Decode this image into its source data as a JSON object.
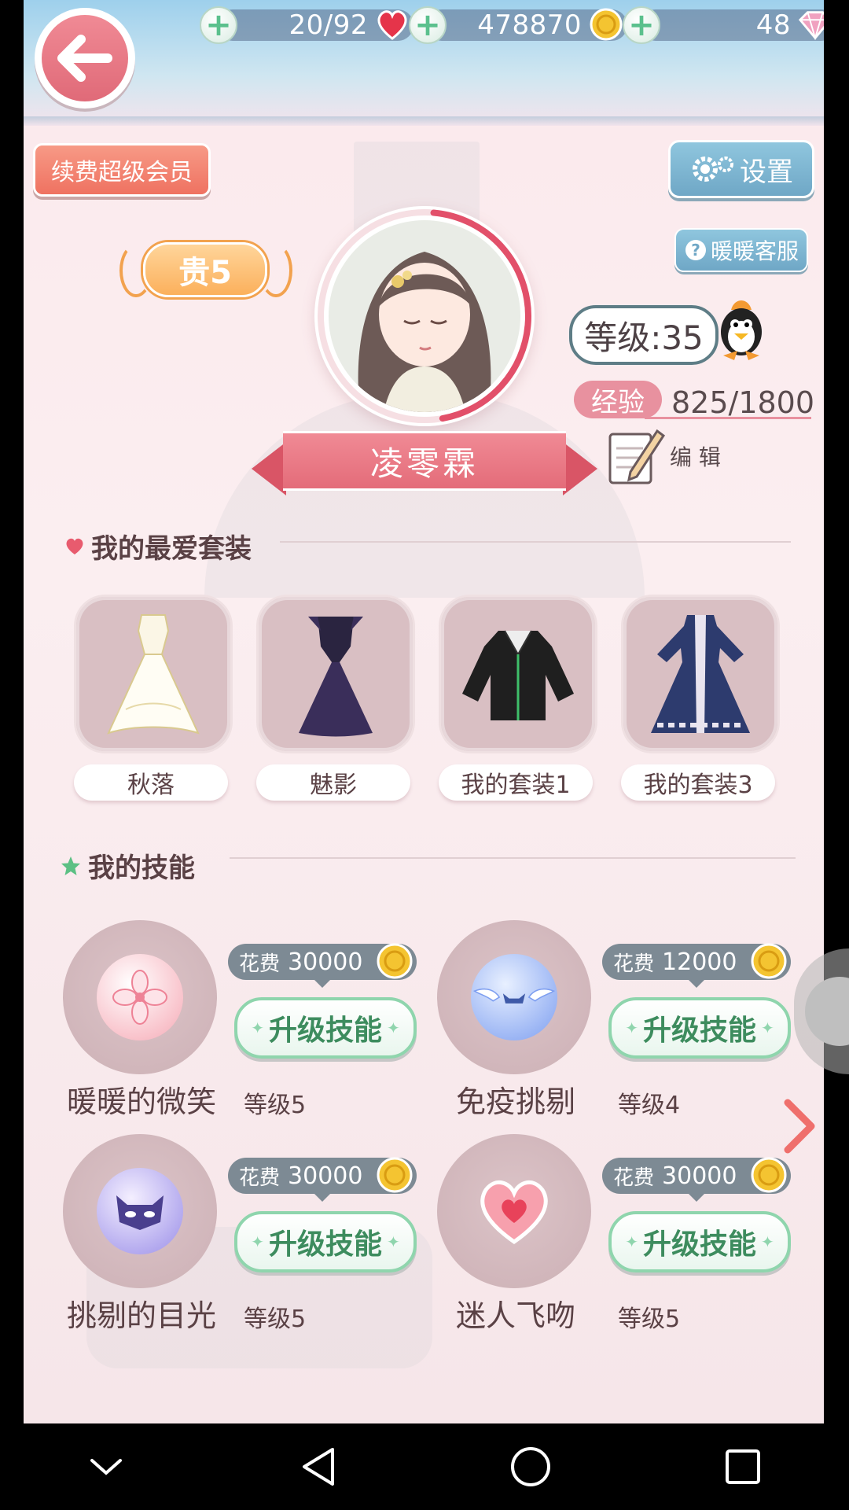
{
  "resources": {
    "stamina": "20/92",
    "gold": "478870",
    "diamonds": "48"
  },
  "buttons": {
    "vip": "续费超级会员",
    "settings": "设置",
    "service": "暖暖客服",
    "edit": "编 辑"
  },
  "profile": {
    "noble_rank": "贵5",
    "level": "等级:35",
    "exp_label": "经验",
    "exp_value": "825/1800",
    "name": "凌零霖"
  },
  "favorites": {
    "title": "我的最爱套装",
    "items": [
      {
        "label": "秋落"
      },
      {
        "label": "魅影"
      },
      {
        "label": "我的套装1"
      },
      {
        "label": "我的套装3"
      }
    ]
  },
  "skills": {
    "title": "我的技能",
    "cost_label": "花费",
    "upgrade_label": "升级技能",
    "items": [
      {
        "name": "暖暖的微笑",
        "cost": "30000",
        "level": "等级5"
      },
      {
        "name": "免疫挑剔",
        "cost": "12000",
        "level": "等级4"
      },
      {
        "name": "挑剔的目光",
        "cost": "30000",
        "level": "等级5"
      },
      {
        "name": "迷人飞吻",
        "cost": "30000",
        "level": "等级5"
      }
    ]
  },
  "colors": {
    "accent_pink": "#e46c79",
    "button_blue": "#6fa7c6",
    "upgrade_green": "#8fd5ad"
  }
}
